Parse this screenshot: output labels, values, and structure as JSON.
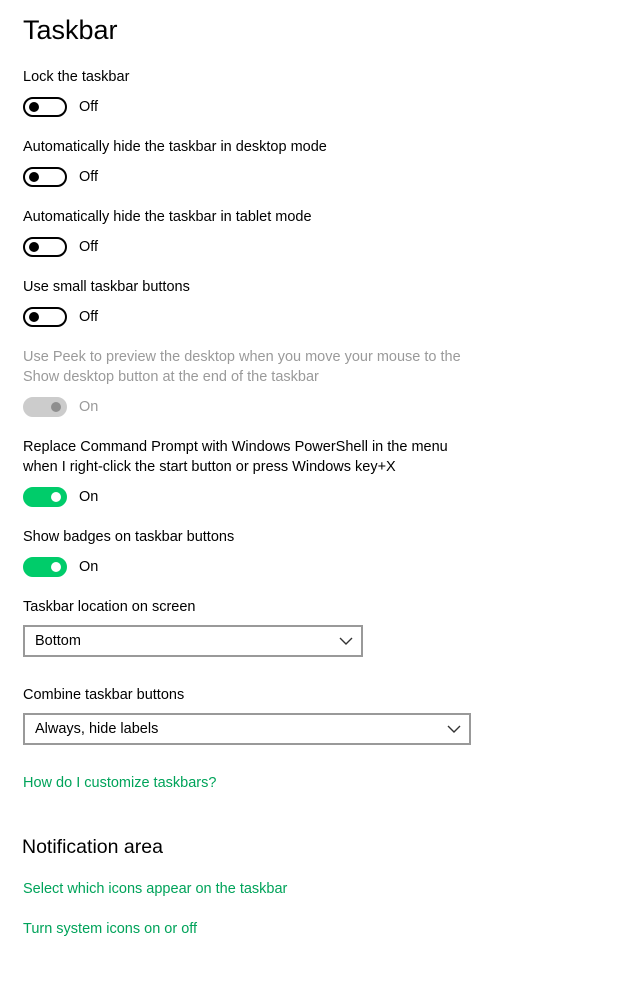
{
  "page": {
    "title": "Taskbar"
  },
  "toggles": [
    {
      "label": "Lock the taskbar",
      "state": "Off"
    },
    {
      "label": "Automatically hide the taskbar in desktop mode",
      "state": "Off"
    },
    {
      "label": "Automatically hide the taskbar in tablet mode",
      "state": "Off"
    },
    {
      "label": "Use small taskbar buttons",
      "state": "Off"
    },
    {
      "label": "Use Peek to preview the desktop when you move your mouse to the Show desktop button at the end of the taskbar",
      "state": "On",
      "disabled": true
    },
    {
      "label": "Replace Command Prompt with Windows PowerShell in the menu when I right-click the start button or press Windows key+X",
      "state": "On"
    },
    {
      "label": "Show badges on taskbar buttons",
      "state": "On"
    }
  ],
  "location": {
    "label": "Taskbar location on screen",
    "value": "Bottom"
  },
  "combine": {
    "label": "Combine taskbar buttons",
    "value": "Always, hide labels"
  },
  "help_link": "How do I customize taskbars?",
  "notification": {
    "title": "Notification area",
    "links": [
      "Select which icons appear on the taskbar",
      "Turn system icons on or off"
    ]
  },
  "colors": {
    "accent": "#00cc6a",
    "link": "#00a35a",
    "disabled": "#9a9a9a"
  },
  "icons": {
    "dropdown": "chevron-down-icon"
  }
}
